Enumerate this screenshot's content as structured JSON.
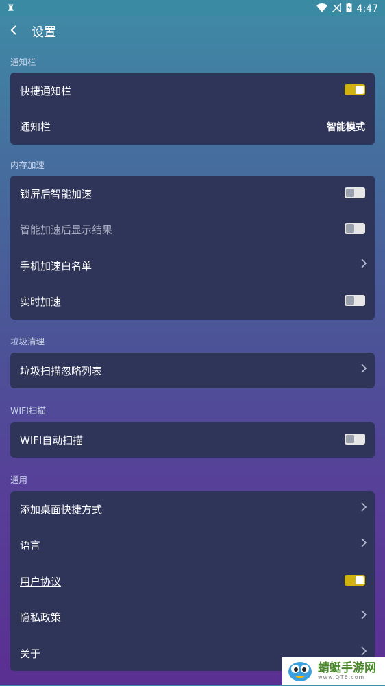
{
  "status_bar": {
    "time": "4:47"
  },
  "header": {
    "title": "设置"
  },
  "sections": [
    {
      "title": "通知栏",
      "rows": [
        {
          "label": "快捷通知栏",
          "control": "toggle",
          "on": true
        },
        {
          "label": "通知栏",
          "control": "value",
          "value": "智能模式"
        }
      ]
    },
    {
      "title": "内存加速",
      "rows": [
        {
          "label": "锁屏后智能加速",
          "control": "toggle",
          "on": false
        },
        {
          "label": "智能加速后显示结果",
          "control": "toggle",
          "on": false,
          "dim": true
        },
        {
          "label": "手机加速白名单",
          "control": "chevron"
        },
        {
          "label": "实时加速",
          "control": "toggle",
          "on": false
        }
      ]
    },
    {
      "title": "垃圾清理",
      "rows": [
        {
          "label": "垃圾扫描忽略列表",
          "control": "chevron"
        }
      ]
    },
    {
      "title": "WIFI扫描",
      "rows": [
        {
          "label": "WIFI自动扫描",
          "control": "toggle",
          "on": false
        }
      ]
    },
    {
      "title": "通用",
      "rows": [
        {
          "label": "添加桌面快捷方式",
          "control": "chevron"
        },
        {
          "label": "语言",
          "control": "chevron"
        },
        {
          "label": "用户协议",
          "control": "toggle",
          "on": true,
          "underline": true
        },
        {
          "label": "隐私政策",
          "control": "chevron"
        },
        {
          "label": "关于",
          "control": "chevron"
        }
      ]
    }
  ],
  "watermark": {
    "name": "蜻蜓手游网",
    "url": "www.QT6.com"
  },
  "colors": {
    "toggle_on": "#d0b310",
    "card": "#2e3559"
  }
}
